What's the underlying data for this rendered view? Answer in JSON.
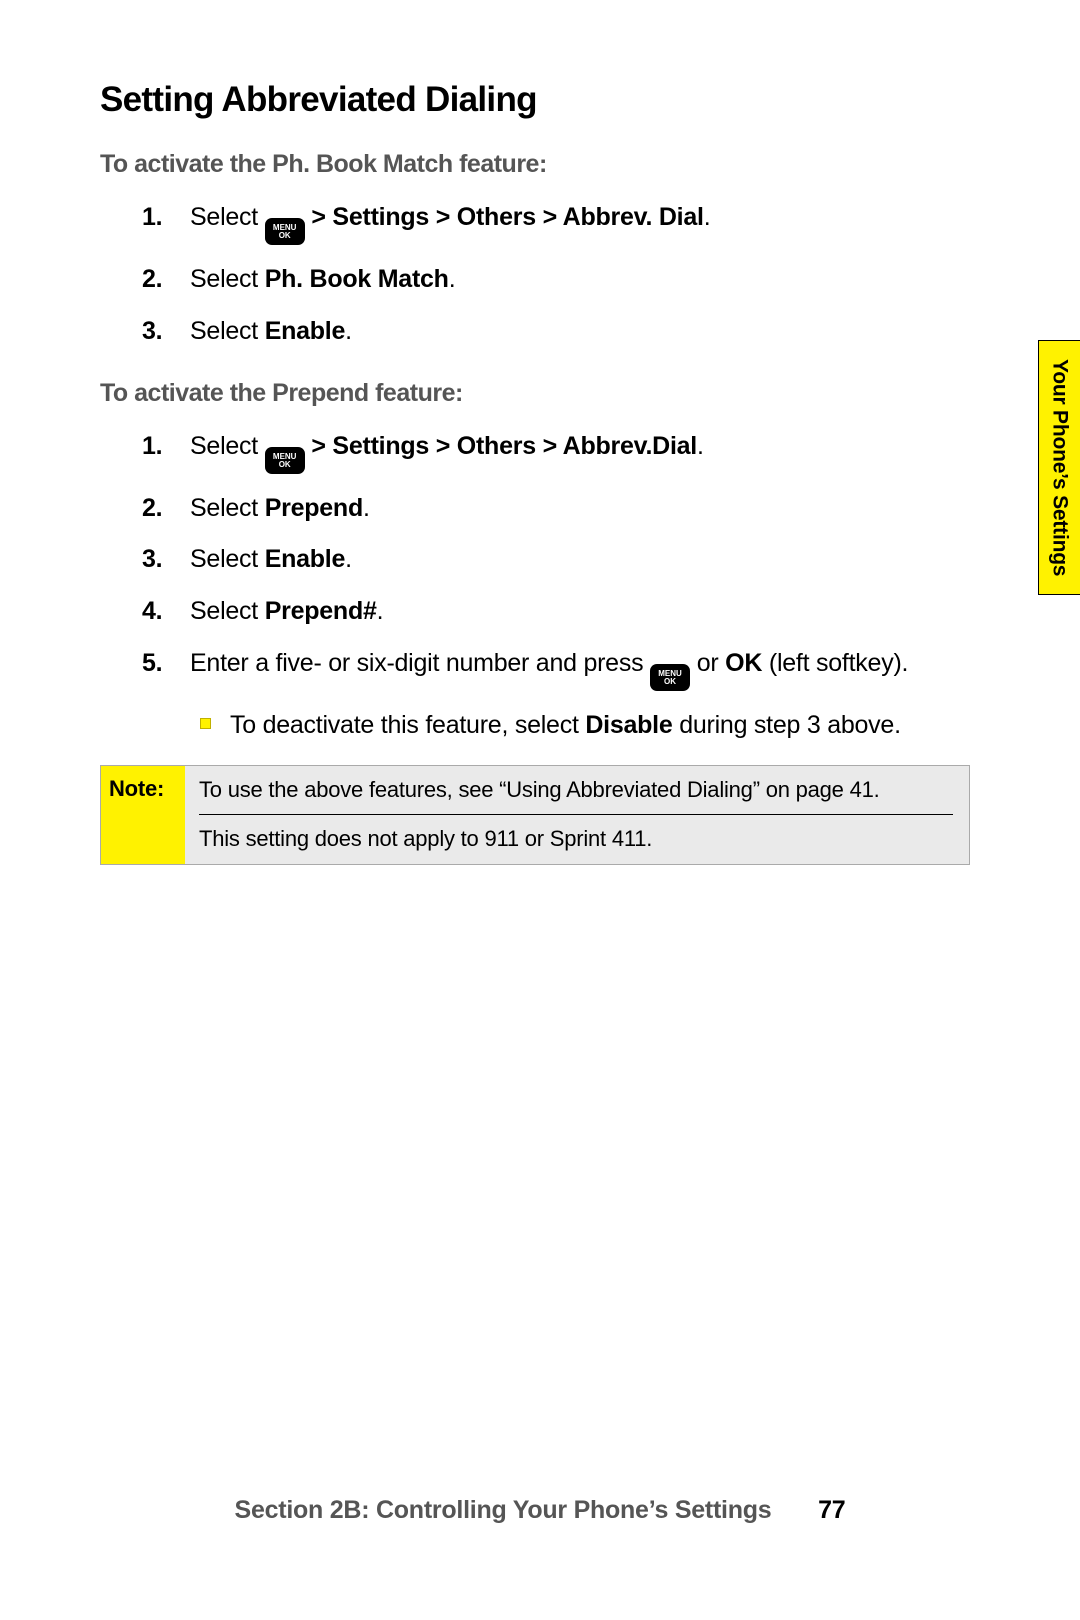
{
  "heading": "Setting Abbreviated Dialing",
  "section_a": {
    "title": "To activate the Ph. Book Match feature:",
    "items": [
      {
        "num": "1.",
        "pre": "Select ",
        "has_key": true,
        "bold": " > Settings > Others > Abbrev. Dial",
        "post": "."
      },
      {
        "num": "2.",
        "pre": "Select ",
        "has_key": false,
        "bold": "Ph. Book Match",
        "post": "."
      },
      {
        "num": "3.",
        "pre": "Select ",
        "has_key": false,
        "bold": "Enable",
        "post": "."
      }
    ]
  },
  "section_b": {
    "title": "To activate the Prepend feature:",
    "items": [
      {
        "num": "1.",
        "pre": "Select ",
        "has_key": true,
        "bold": " > Settings > Others > Abbrev.Dial",
        "post": "."
      },
      {
        "num": "2.",
        "pre": "Select ",
        "has_key": false,
        "bold": "Prepend",
        "post": "."
      },
      {
        "num": "3.",
        "pre": "Select ",
        "has_key": false,
        "bold": "Enable",
        "post": "."
      },
      {
        "num": "4.",
        "pre": "Select ",
        "has_key": false,
        "bold": "Prepend#",
        "post": "."
      }
    ],
    "item5": {
      "num": "5.",
      "t1": "Enter a five- or six-digit number and press ",
      "t2": " or ",
      "b2": "OK",
      "t3": " (left softkey)."
    },
    "bullet": {
      "t1": "To deactivate this feature, select ",
      "b1": "Disable",
      "t2": " during step 3 above."
    }
  },
  "menu_key": {
    "line1": "MENU",
    "line2": "OK"
  },
  "note": {
    "label": "Note:",
    "line1": "To use the above features, see “Using Abbreviated Dialing” on page 41.",
    "line2": "This setting does not apply to 911 or Sprint 411."
  },
  "side_tab": "Your Phone’s Settings",
  "footer": {
    "section": "Section 2B: Controlling Your Phone’s Settings",
    "page": "77"
  }
}
